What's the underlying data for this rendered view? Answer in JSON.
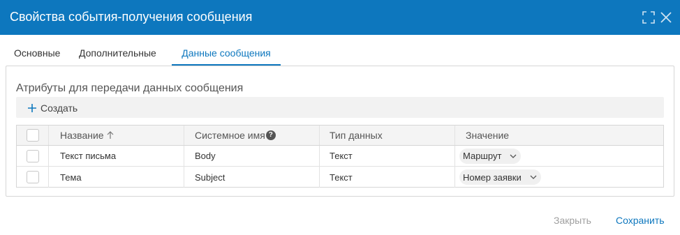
{
  "dialog": {
    "title": "Свойства события-получения сообщения"
  },
  "tabs": [
    {
      "label": "Основные",
      "active": false
    },
    {
      "label": "Дополнительные",
      "active": false
    },
    {
      "label": "Данные сообщения",
      "active": true
    }
  ],
  "section": {
    "title": "Атрибуты для передачи данных сообщения",
    "create_label": "Создать"
  },
  "grid": {
    "columns": [
      "Название",
      "Системное имя",
      "Тип данных",
      "Значение"
    ],
    "help_glyph": "?",
    "rows": [
      {
        "name": "Текст письма",
        "system_name": "Body",
        "type": "Текст",
        "value": "Маршрут"
      },
      {
        "name": "Тема",
        "system_name": "Subject",
        "type": "Текст",
        "value": "Номер заявки"
      }
    ]
  },
  "footer": {
    "close_label": "Закрыть",
    "save_label": "Сохранить"
  },
  "colors": {
    "accent": "#0d77be",
    "disabled_text": "#a0a0a0"
  },
  "icons": [
    "expand-icon",
    "close-icon",
    "plus-icon",
    "sort-asc-icon",
    "help-icon",
    "chevron-down-icon"
  ]
}
